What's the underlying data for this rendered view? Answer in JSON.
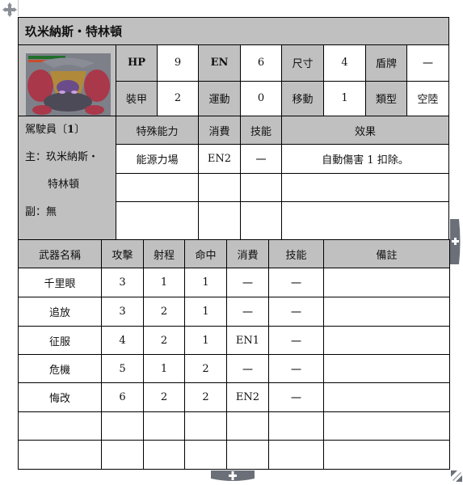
{
  "unit": {
    "title": "玖米納斯・特林頓",
    "image_alt": "機體圖像"
  },
  "stats": {
    "row1": [
      {
        "label": "HP",
        "value": "9"
      },
      {
        "label": "EN",
        "value": "6"
      },
      {
        "label": "尺寸",
        "value": "4"
      },
      {
        "label": "盾牌",
        "value": "一"
      }
    ],
    "row2": [
      {
        "label": "裝甲",
        "value": "2"
      },
      {
        "label": "運動",
        "value": "0"
      },
      {
        "label": "移動",
        "value": "1"
      },
      {
        "label": "類型",
        "value": "空陸"
      }
    ]
  },
  "pilot": {
    "crew_label": "駕駛員〔",
    "crew_count": "1",
    "crew_close": "〕",
    "main_line1": "主：玖米納斯・",
    "main_line2": "特林頓",
    "sub": "副：無"
  },
  "special": {
    "headers": [
      "特殊能力",
      "消費",
      "技能",
      "效果"
    ],
    "rows": [
      [
        "能源力場",
        "EN2",
        "一",
        "自動傷害 1 扣除。"
      ],
      [
        "",
        "",
        "",
        ""
      ],
      [
        "",
        "",
        "",
        ""
      ]
    ]
  },
  "weapons": {
    "headers": [
      "武器名稱",
      "攻擊",
      "射程",
      "命中",
      "消費",
      "技能",
      "備註"
    ],
    "rows": [
      [
        "千里眼",
        "3",
        "1",
        "1",
        "一",
        "一",
        ""
      ],
      [
        "追放",
        "3",
        "2",
        "1",
        "一",
        "一",
        ""
      ],
      [
        "征服",
        "4",
        "2",
        "1",
        "EN1",
        "一",
        ""
      ],
      [
        "危機",
        "5",
        "1",
        "2",
        "一",
        "一",
        ""
      ],
      [
        "悔改",
        "6",
        "2",
        "2",
        "EN2",
        "一",
        ""
      ],
      [
        "",
        "",
        "",
        "",
        "",
        "",
        ""
      ],
      [
        "",
        "",
        "",
        "",
        "",
        "",
        ""
      ]
    ]
  },
  "colors": {
    "header_gray": "#c0c0c0",
    "border": "#000000",
    "control_gray": "#6b7078"
  }
}
